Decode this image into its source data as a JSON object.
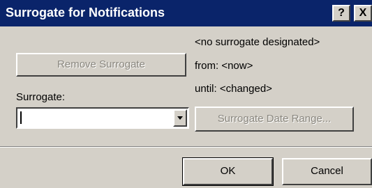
{
  "window": {
    "title": "Surrogate for Notifications",
    "help_button": "?",
    "close_button": "X"
  },
  "surrogate_info": {
    "status": "<no surrogate designated>",
    "from": "from: <now>",
    "until": "until: <changed>"
  },
  "buttons": {
    "remove_surrogate": "Remove Surrogate",
    "surrogate_date_range": "Surrogate Date Range...",
    "ok": "OK",
    "cancel": "Cancel"
  },
  "surrogate_field": {
    "label": "Surrogate:",
    "value": ""
  },
  "colors": {
    "title_bar": "#0a246a",
    "dialog_face": "#d4d0c8",
    "disabled_text": "#8a877f"
  },
  "icons": {
    "dropdown": "chevron-down-icon"
  }
}
